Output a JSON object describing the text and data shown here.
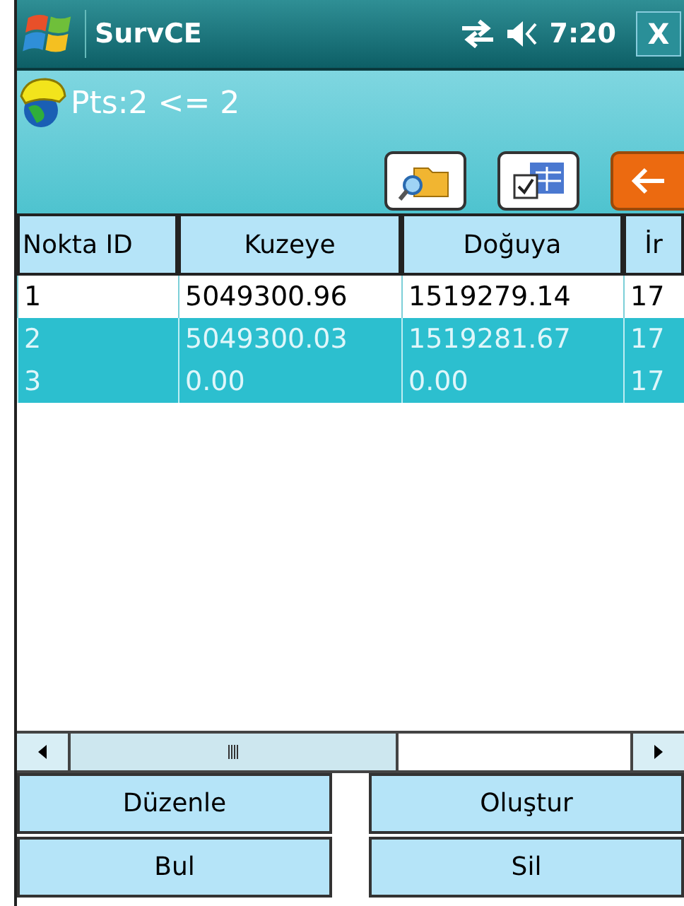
{
  "window": {
    "title": "SurvCE",
    "time": "7:20",
    "close": "X"
  },
  "status": {
    "text": "Pts:2 <= 2"
  },
  "toolbar": {
    "buttons": [
      {
        "kind": "folder-search"
      },
      {
        "kind": "table-check"
      },
      {
        "kind": "back"
      }
    ]
  },
  "table": {
    "columns": [
      "Nokta ID",
      "Kuzeye",
      "Doğuya",
      "İr"
    ],
    "rows": [
      {
        "cells": [
          "1",
          "5049300.96",
          "1519279.14",
          "17"
        ],
        "selected": false
      },
      {
        "cells": [
          "2",
          "5049300.03",
          "1519281.67",
          "17"
        ],
        "selected": true
      },
      {
        "cells": [
          "3",
          "0.00",
          "0.00",
          "17"
        ],
        "selected": true
      }
    ]
  },
  "buttons": [
    [
      "Düzenle",
      "Oluştur"
    ],
    [
      "Bul",
      "Sil"
    ]
  ]
}
